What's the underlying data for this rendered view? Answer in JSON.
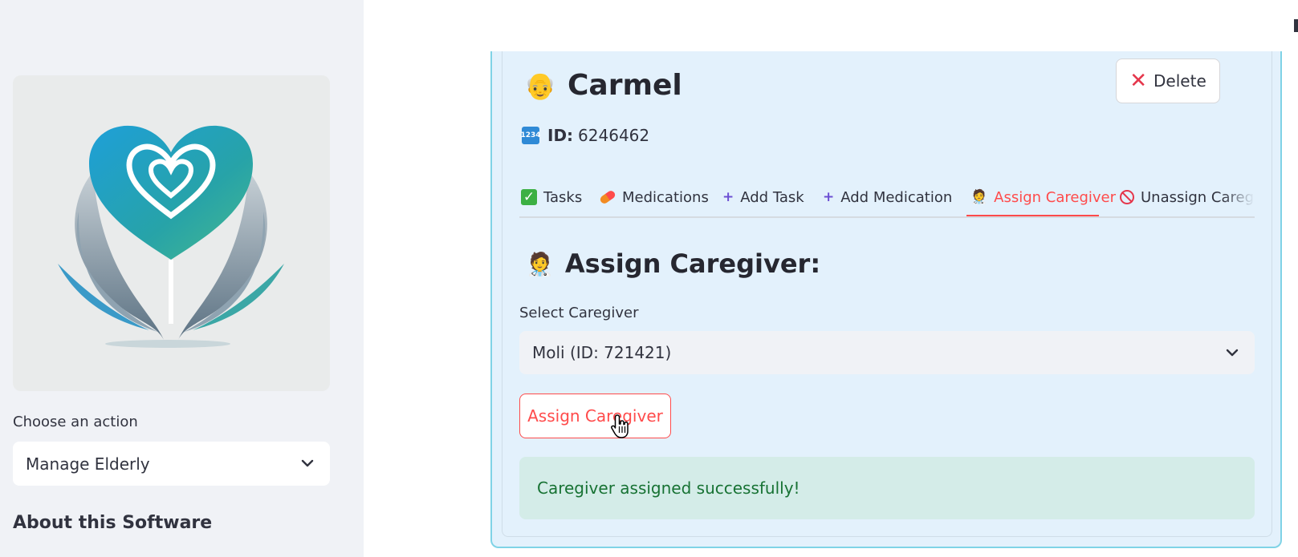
{
  "sidebar": {
    "action_label": "Choose an action",
    "action_value": "Manage Elderly",
    "about_title": "About this Software"
  },
  "profile": {
    "emoji": "👴",
    "name": "Carmel",
    "id_icon": "🔢",
    "id_label": "ID:",
    "id_value": "6246462",
    "delete_label": "Delete"
  },
  "tabs": [
    {
      "label": "Tasks",
      "icon": "check-icon"
    },
    {
      "label": "Medications",
      "icon": "pill-icon"
    },
    {
      "label": "Add Task",
      "icon": "plus-icon"
    },
    {
      "label": "Add Medication",
      "icon": "plus-icon"
    },
    {
      "label": "Assign Caregiver",
      "icon": "health-worker-icon",
      "active": true
    },
    {
      "label": "Unassign Caregiver",
      "icon": "no-entry-icon"
    }
  ],
  "assign": {
    "emoji": "🧑‍⚕️",
    "title": "Assign Caregiver:",
    "select_label": "Select Caregiver",
    "select_value": "Moli (ID: 721421)",
    "button_label": "Assign Caregiver",
    "success_message": "Caregiver assigned successfully!"
  },
  "colors": {
    "accent": "#ff4b4b",
    "card_bg": "#e3f1fc",
    "success_bg": "#d4ece8",
    "success_text": "#177233"
  }
}
